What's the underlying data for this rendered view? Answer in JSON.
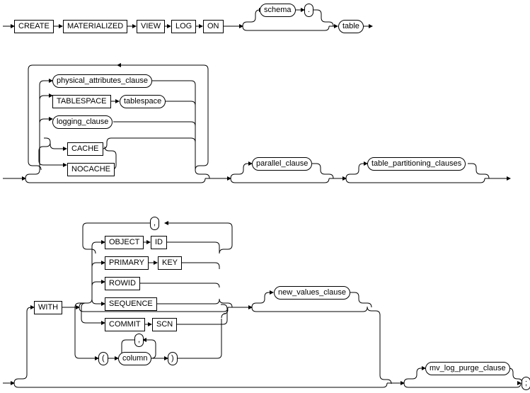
{
  "title": "CREATE MATERIALIZED VIEW LOG syntax diagram",
  "keywords": {
    "create": "CREATE",
    "materialized": "MATERIALIZED",
    "view": "VIEW",
    "log": "LOG",
    "on": "ON",
    "tablespace": "TABLESPACE",
    "cache": "CACHE",
    "nocache": "NOCACHE",
    "with": "WITH",
    "object": "OBJECT",
    "id": "ID",
    "primary": "PRIMARY",
    "key": "KEY",
    "rowid": "ROWID",
    "sequence": "SEQUENCE",
    "commit": "COMMIT",
    "scn": "SCN"
  },
  "nonterminals": {
    "schema": "schema",
    "table": "table",
    "physical_attributes_clause": "physical_attributes_clause",
    "tablespace": "tablespace",
    "logging_clause": "logging_clause",
    "parallel_clause": "parallel_clause",
    "table_partitioning_clauses": "table_partitioning_clauses",
    "new_values_clause": "new_values_clause",
    "column": "column",
    "mv_log_purge_clause": "mv_log_purge_clause"
  },
  "punct": {
    "dot": ".",
    "comma": ",",
    "lparen": "(",
    "rparen": ")",
    "semi": ";"
  },
  "chart_data": {
    "type": "railroad-diagram",
    "statement": "CREATE MATERIALIZED VIEW LOG ON [schema .] table",
    "optional_blocks": [
      {
        "repeating": true,
        "choices": [
          "physical_attributes_clause",
          "TABLESPACE tablespace",
          "logging_clause",
          {
            "choices": [
              "CACHE",
              "NOCACHE"
            ]
          }
        ]
      },
      {
        "optional": "parallel_clause"
      },
      {
        "optional": "table_partitioning_clauses"
      }
    ],
    "with_block": {
      "keyword": "WITH",
      "optional": true,
      "choices_repeating_comma": [
        "OBJECT ID",
        "PRIMARY KEY",
        "ROWID",
        "SEQUENCE",
        "COMMIT SCN"
      ],
      "alt_column_list": "( column [, column]... )",
      "then_optional": "new_values_clause"
    },
    "then_optional": "mv_log_purge_clause",
    "terminator": ";"
  }
}
